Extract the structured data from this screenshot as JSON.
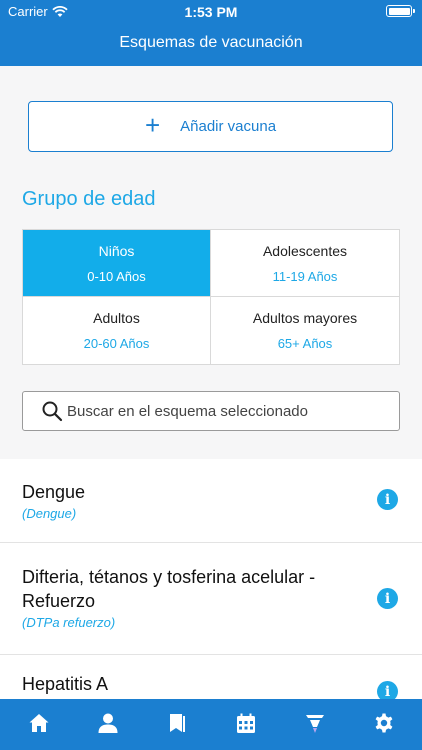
{
  "status_bar": {
    "carrier": "Carrier",
    "time": "1:53 PM"
  },
  "header": {
    "title": "Esquemas de vacunación"
  },
  "add_button": {
    "label": "Añadir vacuna",
    "icon": "plus-icon"
  },
  "age_group": {
    "title": "Grupo de edad",
    "options": [
      {
        "name": "Niños",
        "range": "0-10 Años",
        "selected": true
      },
      {
        "name": "Adolescentes",
        "range": "11-19 Años",
        "selected": false
      },
      {
        "name": "Adultos",
        "range": "20-60 Años",
        "selected": false
      },
      {
        "name": "Adultos mayores",
        "range": "65+ Años",
        "selected": false
      }
    ]
  },
  "search": {
    "placeholder": "Buscar en el esquema seleccionado",
    "value": ""
  },
  "vaccines": [
    {
      "name": "Dengue",
      "abbr": "(Dengue)"
    },
    {
      "name": "Difteria, tétanos y tosferina acelular - Refuerzo",
      "abbr": "(DTPa refuerzo)"
    },
    {
      "name": "Hepatitis A",
      "abbr": ""
    }
  ],
  "tabs": [
    {
      "icon": "home-icon"
    },
    {
      "icon": "person-icon"
    },
    {
      "icon": "bookmark-icon"
    },
    {
      "icon": "calendar-icon"
    },
    {
      "icon": "syringe-icon"
    },
    {
      "icon": "gear-icon"
    }
  ],
  "colors": {
    "primary": "#1b7fd0",
    "accent": "#1ea8e6",
    "selected": "#12adea"
  }
}
